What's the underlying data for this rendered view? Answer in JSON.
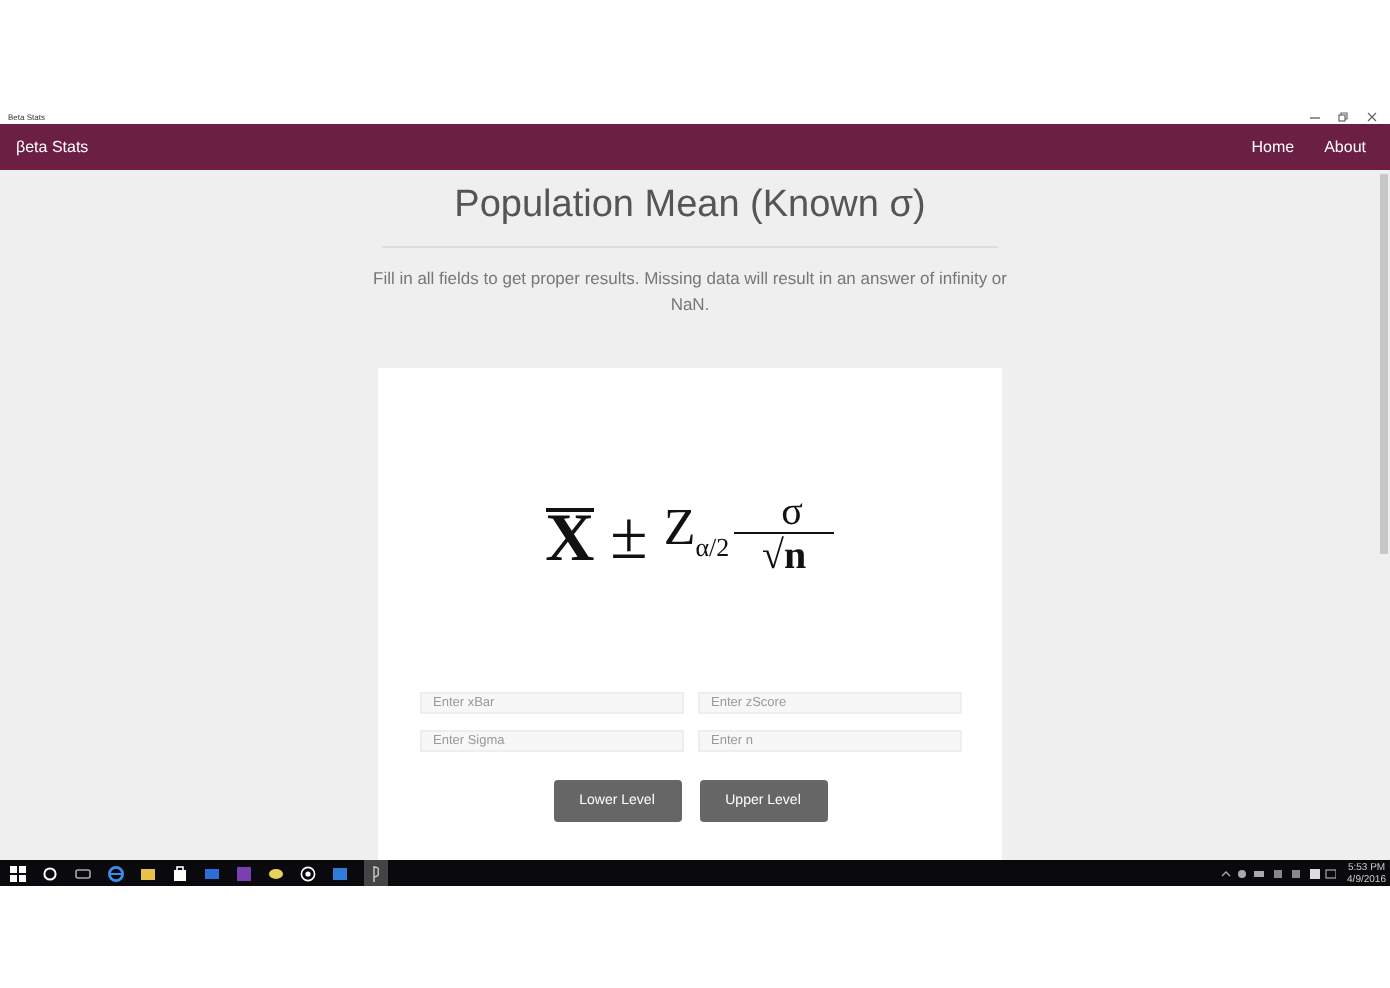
{
  "window": {
    "title": "Beta Stats"
  },
  "navbar": {
    "brand": "βeta Stats",
    "links": [
      {
        "label": "Home"
      },
      {
        "label": "About"
      }
    ]
  },
  "page": {
    "heading": "Population Mean (Known σ)",
    "note": "Fill in all fields to get proper results. Missing data will result in an answer of infinity or NaN."
  },
  "formula": {
    "mean": "X",
    "plus_minus": "±",
    "z": "Z",
    "z_subscript": "α/2",
    "numerator": "σ",
    "denominator": "√n"
  },
  "fields": [
    {
      "placeholder": "Enter xBar"
    },
    {
      "placeholder": "Enter zScore"
    },
    {
      "placeholder": "Enter Sigma"
    },
    {
      "placeholder": "Enter n"
    }
  ],
  "buttons": [
    {
      "label": "Lower Level"
    },
    {
      "label": "Upper Level"
    }
  ],
  "taskbar": {
    "time": "5:53 PM",
    "date": "4/9/2016"
  }
}
